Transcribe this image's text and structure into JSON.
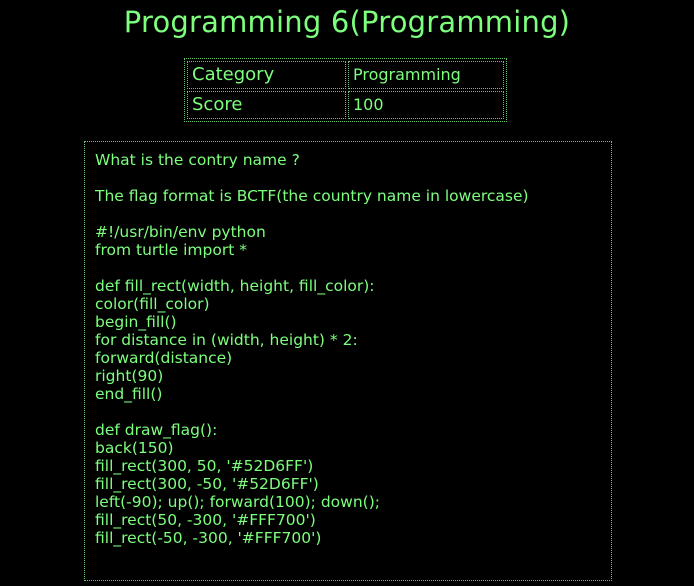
{
  "page": {
    "title": "Programming 6(Programming)"
  },
  "info": {
    "rows": [
      {
        "key": "Category",
        "value": "Programming"
      },
      {
        "key": "Score",
        "value": "100"
      }
    ]
  },
  "description": {
    "lines": [
      "What is the contry name ?",
      "",
      "The flag format is BCTF(the country name in lowercase)",
      "",
      "#!/usr/bin/env python",
      "from turtle import *",
      "",
      "def fill_rect(width, height, fill_color):",
      "color(fill_color)",
      "begin_fill()",
      "for distance in (width, height) * 2:",
      "forward(distance)",
      "right(90)",
      "end_fill()",
      "",
      "def draw_flag():",
      "back(150)",
      "fill_rect(300, 50, '#52D6FF')",
      "fill_rect(300, -50, '#52D6FF')",
      "left(-90); up(); forward(100); down();",
      "fill_rect(50, -300, '#FFF700')",
      "fill_rect(-50, -300, '#FFF700')"
    ]
  },
  "theme": {
    "background": "#000000",
    "text": "#7dff7d",
    "border": "#63c963"
  }
}
